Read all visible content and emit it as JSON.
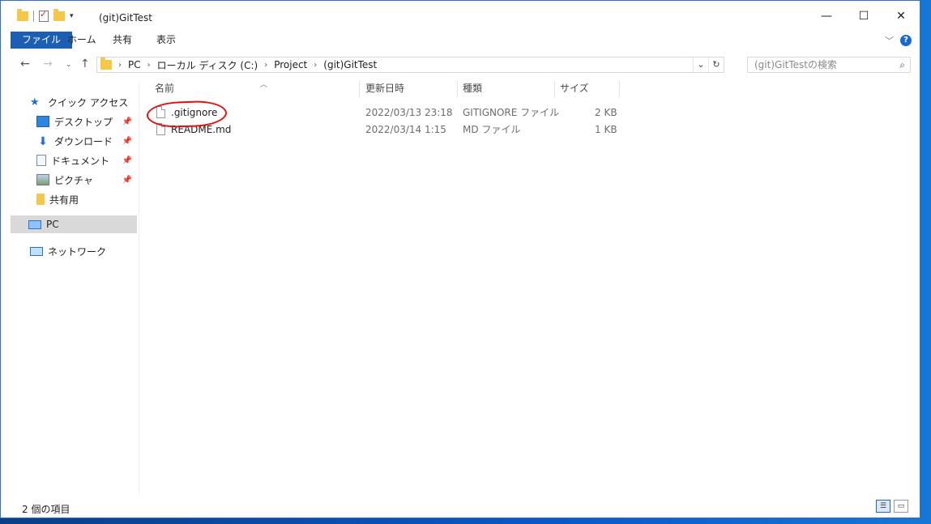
{
  "window": {
    "title": "(git)GitTest"
  },
  "ribbon": {
    "tabs": [
      "ファイル",
      "ホーム",
      "共有",
      "表示"
    ]
  },
  "address": {
    "crumbs": [
      "PC",
      "ローカル ディスク (C:)",
      "Project",
      "(git)GitTest"
    ],
    "search_placeholder": "(git)GitTestの検索"
  },
  "nav": {
    "quick_access": "クイック アクセス",
    "items": [
      "デスクトップ",
      "ダウンロード",
      "ドキュメント",
      "ピクチャ",
      "共有用"
    ],
    "pc": "PC",
    "network": "ネットワーク"
  },
  "columns": [
    "名前",
    "更新日時",
    "種類",
    "サイズ"
  ],
  "files": [
    {
      "name": ".gitignore",
      "date": "2022/03/13 23:18",
      "type": "GITIGNORE ファイル",
      "size": "2 KB"
    },
    {
      "name": "README.md",
      "date": "2022/03/14 1:15",
      "type": "MD ファイル",
      "size": "1 KB"
    }
  ],
  "status": {
    "count": "2 個の項目"
  }
}
